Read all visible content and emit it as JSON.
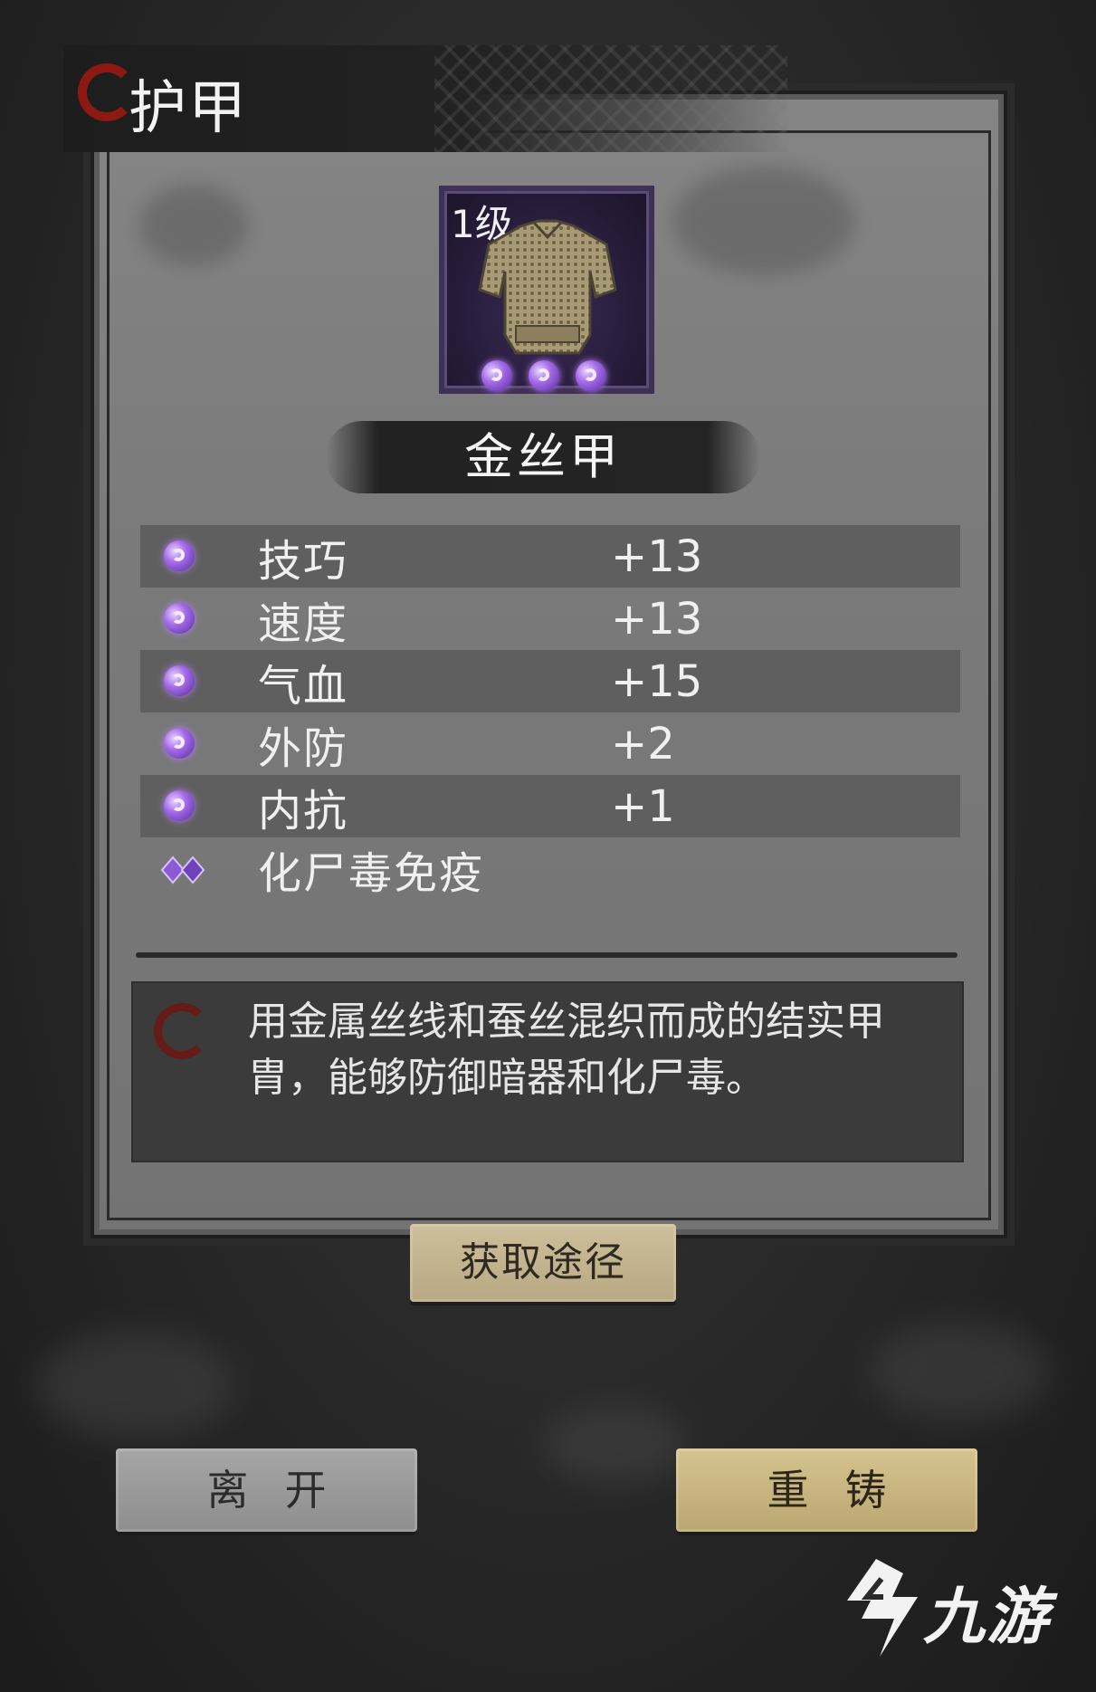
{
  "header": {
    "title": "护甲"
  },
  "item": {
    "level": "1级",
    "name": "金丝甲",
    "quality_orbs": 3,
    "frame_color": "#3e3156"
  },
  "stats": [
    {
      "label": "技巧",
      "value": "+13",
      "icon": "purple-swirl-icon"
    },
    {
      "label": "速度",
      "value": "+13",
      "icon": "purple-swirl-icon"
    },
    {
      "label": "气血",
      "value": "+15",
      "icon": "purple-swirl-icon"
    },
    {
      "label": "外防",
      "value": "+2",
      "icon": "purple-swirl-icon"
    },
    {
      "label": "内抗",
      "value": "+1",
      "icon": "purple-swirl-icon"
    }
  ],
  "special_effect": {
    "label": "化尸毒免疫",
    "icon": "purple-diamond-icon"
  },
  "description": "用金属丝线和蚕丝混织而成的结实甲胄，能够防御暗器和化尸毒。",
  "buttons": {
    "source": "获取途径",
    "leave": "离开",
    "reforge": "重铸"
  },
  "watermark": {
    "text": "九游"
  },
  "colors": {
    "accent_red": "#8c1a12",
    "quality_purple": "#a46be8",
    "button_gold": "#d6c48f"
  }
}
